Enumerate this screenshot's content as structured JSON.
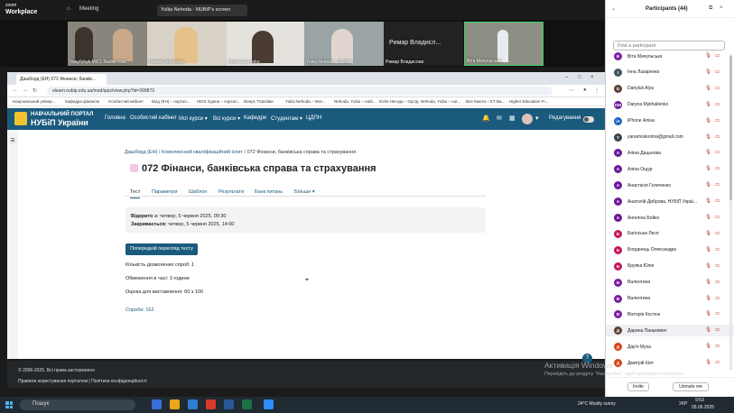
{
  "zoom": {
    "brand_top": "zoom",
    "brand_bottom": "Workplace",
    "meeting_label": "Meeting",
    "screen_share_tab": "Yuliia Nehoda - NUBiP's screen",
    "video_tiles": [
      {
        "name": "Vasyl'chyk MiC1 Nadiia Kiiat"
      },
      {
        "name": "Natalia Shevchuk"
      },
      {
        "name": "Inna Lazarenko"
      },
      {
        "name": "Yuliia Nehoda - NUBiP"
      },
      {
        "name": "Римар Владислав",
        "big": "Римар Владисл..."
      },
      {
        "name": "Віта Мачульська"
      }
    ]
  },
  "browser": {
    "tab_title": "Дашборд (ЕН) 072 Фінанси, банків...",
    "url": "elearn.nubip.edu.ua/mod/quiz/view.php?id=399873",
    "bookmarks": [
      "Національний універ...",
      "Кафедра фінансів",
      "Особистий кабінет",
      "Вхід (ЕН) – портал...",
      "HEIS Єдина – портал...",
      "DeepL Translate",
      "Yuliia Nehoda – Wor...",
      "Nehoda, Yuliia – Auth...",
      "Юлія Негода – Орсід",
      "Nehoda, Yuliia – Aut...",
      "Все Каюта – ЕТ Ва...",
      "Higher Education Fi..."
    ]
  },
  "site": {
    "title_top": "НАВЧАЛЬНИЙ ПОРТАЛ",
    "title_bottom": "НУБіП України",
    "nav": [
      "Головна",
      "Особистий кабінет",
      "Мої курси ▾",
      "Всі курси ▾",
      "Кафедри",
      "Студентам ▾",
      "ЦДПН"
    ],
    "edit_mode_label": "Редагування",
    "breadcrumb": {
      "item1": "Дашборд (ЕН)",
      "item2": "Комплексний кваліфікаційний іспит",
      "current": "072 Фінанси, банківська справа та страхування"
    },
    "page_title": "072 Фінанси, банківська справа та страхування",
    "tabs": [
      "Тест",
      "Параметри",
      "Шаблон",
      "Результати",
      "Банк питань",
      "Більше ▾"
    ],
    "opened_label": "Відкрито з:",
    "opened_value": "четвер, 5 червня 2025, 09:30",
    "closes_label": "Закривається:",
    "closes_value": "четвер, 5 червня 2025, 14:00",
    "preview_button": "Попередній перегляд тесту",
    "attempts_allowed": "Кількість дозволених спроб: 1",
    "time_limit": "Обмеження в часі: 3 години",
    "grading": "Оцінка для виставлення: 60 з 100",
    "attempts_link": "Спроби: 162",
    "footer_copyright": "© 2006-2025. Всі права застережено",
    "footer_links": "Правила користування порталом  |  Політика конфіденційності"
  },
  "participants": {
    "title": "Participants (44)",
    "search_placeholder": "Find a participant",
    "list": [
      {
        "name": "Віта Мачульська",
        "initials": "В",
        "color": "#7b1fa2"
      },
      {
        "name": "Інна Лазаренко",
        "initials": "І",
        "color": "#455a64"
      },
      {
        "name": "Danyluk Alya",
        "initials": "D",
        "color": "#5d4037"
      },
      {
        "name": "Daryna Mykhailenko",
        "initials": "DM",
        "color": "#6a1b9a"
      },
      {
        "name": "iPhone Аліна",
        "initials": "iA",
        "color": "#1565c0"
      },
      {
        "name": "yanamoskorina@gmail.com",
        "initials": "Y",
        "color": "#37474f"
      },
      {
        "name": "Аліна Дацьнова",
        "initials": "А",
        "color": "#6a1b9a"
      },
      {
        "name": "Аліна Ощур",
        "initials": "А",
        "color": "#6a1b9a"
      },
      {
        "name": "Анастасія Голиченко",
        "initials": "А",
        "color": "#6a1b9a"
      },
      {
        "name": "Анатолій Диброва, НУБіП Украї...",
        "initials": "А",
        "color": "#6a1b9a"
      },
      {
        "name": "Ангеліна Бойко",
        "initials": "А",
        "color": "#6a1b9a"
      },
      {
        "name": "Багінська Леся",
        "initials": "Б",
        "color": "#c2185b"
      },
      {
        "name": "Богданець Олександра",
        "initials": "Б",
        "color": "#c2185b"
      },
      {
        "name": "Бруяка Юлія",
        "initials": "Б",
        "color": "#c2185b"
      },
      {
        "name": "Валентина",
        "initials": "В",
        "color": "#7b1fa2"
      },
      {
        "name": "Валентина",
        "initials": "В",
        "color": "#7b1fa2"
      },
      {
        "name": "Вікторія Костюк",
        "initials": "В",
        "color": "#7b1fa2"
      },
      {
        "name": "Дарина Панькевич",
        "initials": "Д",
        "color": "#5d4037"
      },
      {
        "name": "Дар'я Муха",
        "initials": "Д",
        "color": "#d84315"
      },
      {
        "name": "Дмитрій Кіят",
        "initials": "Д",
        "color": "#d84315"
      }
    ],
    "invite_button": "Invite",
    "mute_button": "Unmute me"
  },
  "windows": {
    "watermark_title": "Активація Windows",
    "watermark_sub": "Перейдіть до розділу \"Настройки\", щоб активувати Windows.",
    "search_label": "Пошук",
    "weather": "24°C  Mostly sunny",
    "time": "9:53",
    "date": "05.06.2025",
    "lang": "УКР"
  },
  "colors": {
    "brand": "#1a5a7d",
    "zoom_active": "#3ad35a",
    "muted": "#c62828"
  }
}
